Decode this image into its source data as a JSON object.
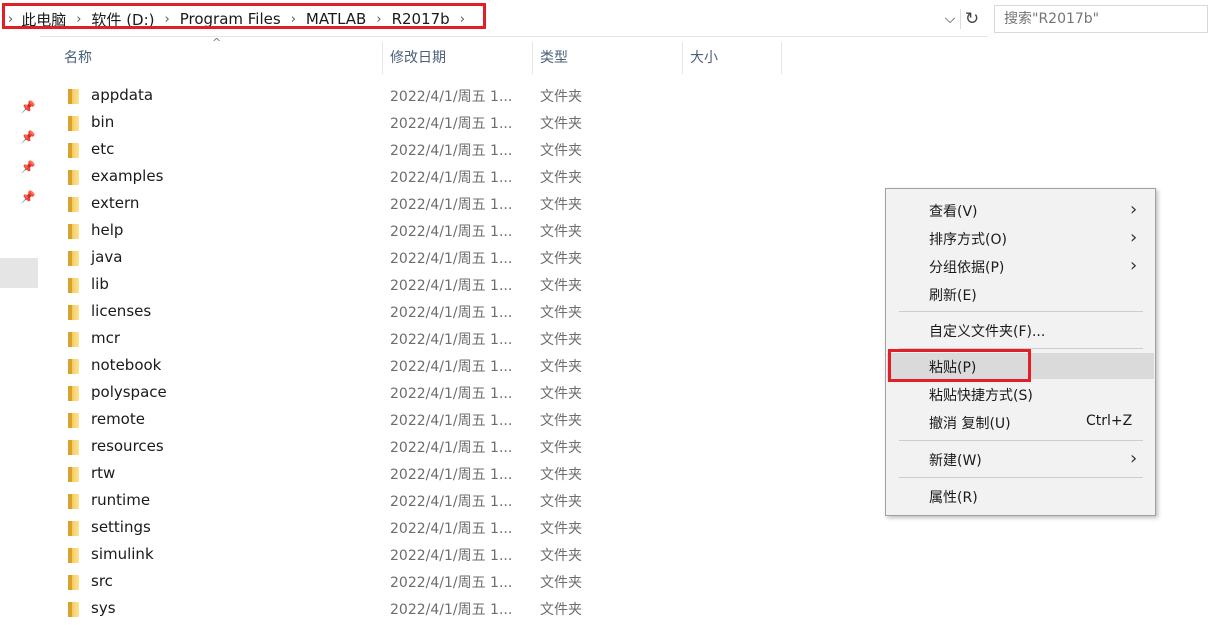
{
  "address": {
    "crumbs": [
      "此电脑",
      "软件 (D:)",
      "Program Files",
      "MATLAB",
      "R2017b"
    ]
  },
  "search": {
    "placeholder": "搜索\"R2017b\""
  },
  "columns": {
    "name": "名称",
    "date": "修改日期",
    "type": "类型",
    "size": "大小"
  },
  "files": [
    {
      "name": "appdata",
      "date": "2022/4/1/周五 1...",
      "type": "文件夹"
    },
    {
      "name": "bin",
      "date": "2022/4/1/周五 1...",
      "type": "文件夹"
    },
    {
      "name": "etc",
      "date": "2022/4/1/周五 1...",
      "type": "文件夹"
    },
    {
      "name": "examples",
      "date": "2022/4/1/周五 1...",
      "type": "文件夹"
    },
    {
      "name": "extern",
      "date": "2022/4/1/周五 1...",
      "type": "文件夹"
    },
    {
      "name": "help",
      "date": "2022/4/1/周五 1...",
      "type": "文件夹"
    },
    {
      "name": "java",
      "date": "2022/4/1/周五 1...",
      "type": "文件夹"
    },
    {
      "name": "lib",
      "date": "2022/4/1/周五 1...",
      "type": "文件夹"
    },
    {
      "name": "licenses",
      "date": "2022/4/1/周五 1...",
      "type": "文件夹"
    },
    {
      "name": "mcr",
      "date": "2022/4/1/周五 1...",
      "type": "文件夹"
    },
    {
      "name": "notebook",
      "date": "2022/4/1/周五 1...",
      "type": "文件夹"
    },
    {
      "name": "polyspace",
      "date": "2022/4/1/周五 1...",
      "type": "文件夹"
    },
    {
      "name": "remote",
      "date": "2022/4/1/周五 1...",
      "type": "文件夹"
    },
    {
      "name": "resources",
      "date": "2022/4/1/周五 1...",
      "type": "文件夹"
    },
    {
      "name": "rtw",
      "date": "2022/4/1/周五 1...",
      "type": "文件夹"
    },
    {
      "name": "runtime",
      "date": "2022/4/1/周五 1...",
      "type": "文件夹"
    },
    {
      "name": "settings",
      "date": "2022/4/1/周五 1...",
      "type": "文件夹"
    },
    {
      "name": "simulink",
      "date": "2022/4/1/周五 1...",
      "type": "文件夹"
    },
    {
      "name": "src",
      "date": "2022/4/1/周五 1...",
      "type": "文件夹"
    },
    {
      "name": "sys",
      "date": "2022/4/1/周五 1...",
      "type": "文件夹"
    }
  ],
  "context_menu": {
    "view": "查看(V)",
    "sort": "排序方式(O)",
    "group": "分组依据(P)",
    "refresh": "刷新(E)",
    "customize": "自定义文件夹(F)...",
    "paste": "粘贴(P)",
    "paste_shortcut": "粘贴快捷方式(S)",
    "undo": "撤消 复制(U)",
    "undo_shortcut": "Ctrl+Z",
    "new": "新建(W)",
    "properties": "属性(R)"
  },
  "colors": {
    "highlight_red": "#e21f26",
    "header_text": "#4c607a",
    "folder": "#f8d775"
  }
}
